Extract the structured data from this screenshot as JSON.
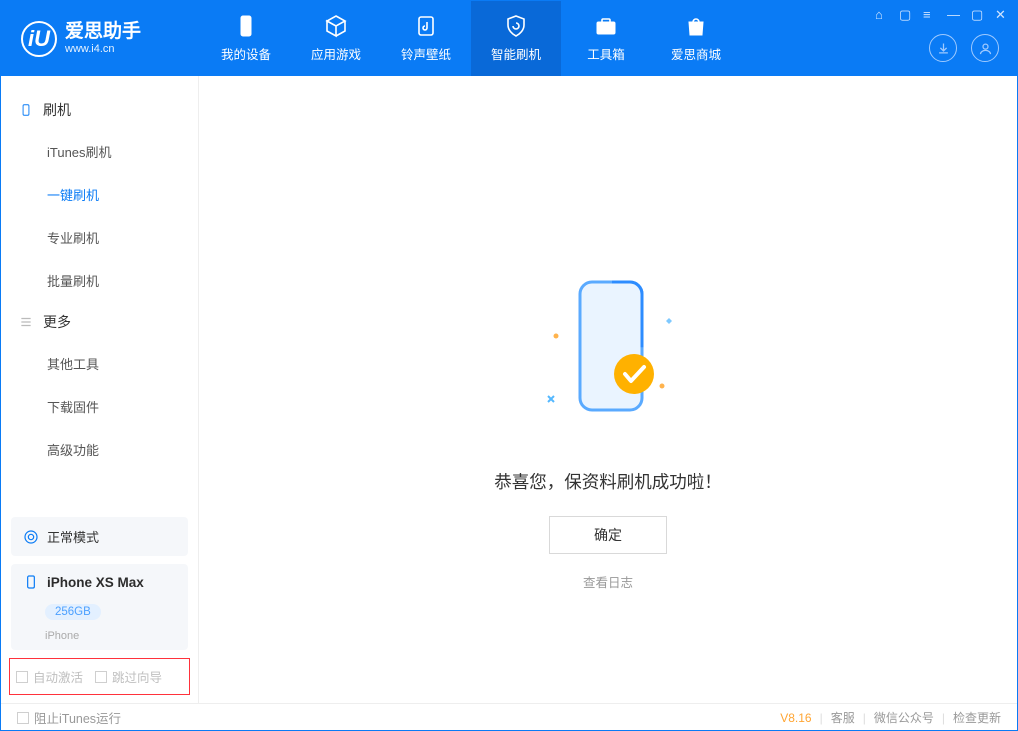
{
  "app": {
    "title": "爱思助手",
    "subtitle": "www.i4.cn"
  },
  "header": {
    "tabs": [
      {
        "label": "我的设备"
      },
      {
        "label": "应用游戏"
      },
      {
        "label": "铃声壁纸"
      },
      {
        "label": "智能刷机"
      },
      {
        "label": "工具箱"
      },
      {
        "label": "爱思商城"
      }
    ]
  },
  "sidebar": {
    "sec1": {
      "header": "刷机",
      "items": [
        "iTunes刷机",
        "一键刷机",
        "专业刷机",
        "批量刷机"
      ]
    },
    "sec2": {
      "header": "更多",
      "items": [
        "其他工具",
        "下载固件",
        "高级功能"
      ]
    },
    "mode": "正常模式",
    "device": {
      "name": "iPhone XS Max",
      "capacity": "256GB",
      "type": "iPhone"
    },
    "opts": {
      "auto_activate": "自动激活",
      "skip_guide": "跳过向导"
    }
  },
  "main": {
    "success_msg": "恭喜您，保资料刷机成功啦！",
    "ok": "确定",
    "view_log": "查看日志"
  },
  "status": {
    "block_itunes": "阻止iTunes运行",
    "version": "V8.16",
    "links": [
      "客服",
      "微信公众号",
      "检查更新"
    ]
  }
}
